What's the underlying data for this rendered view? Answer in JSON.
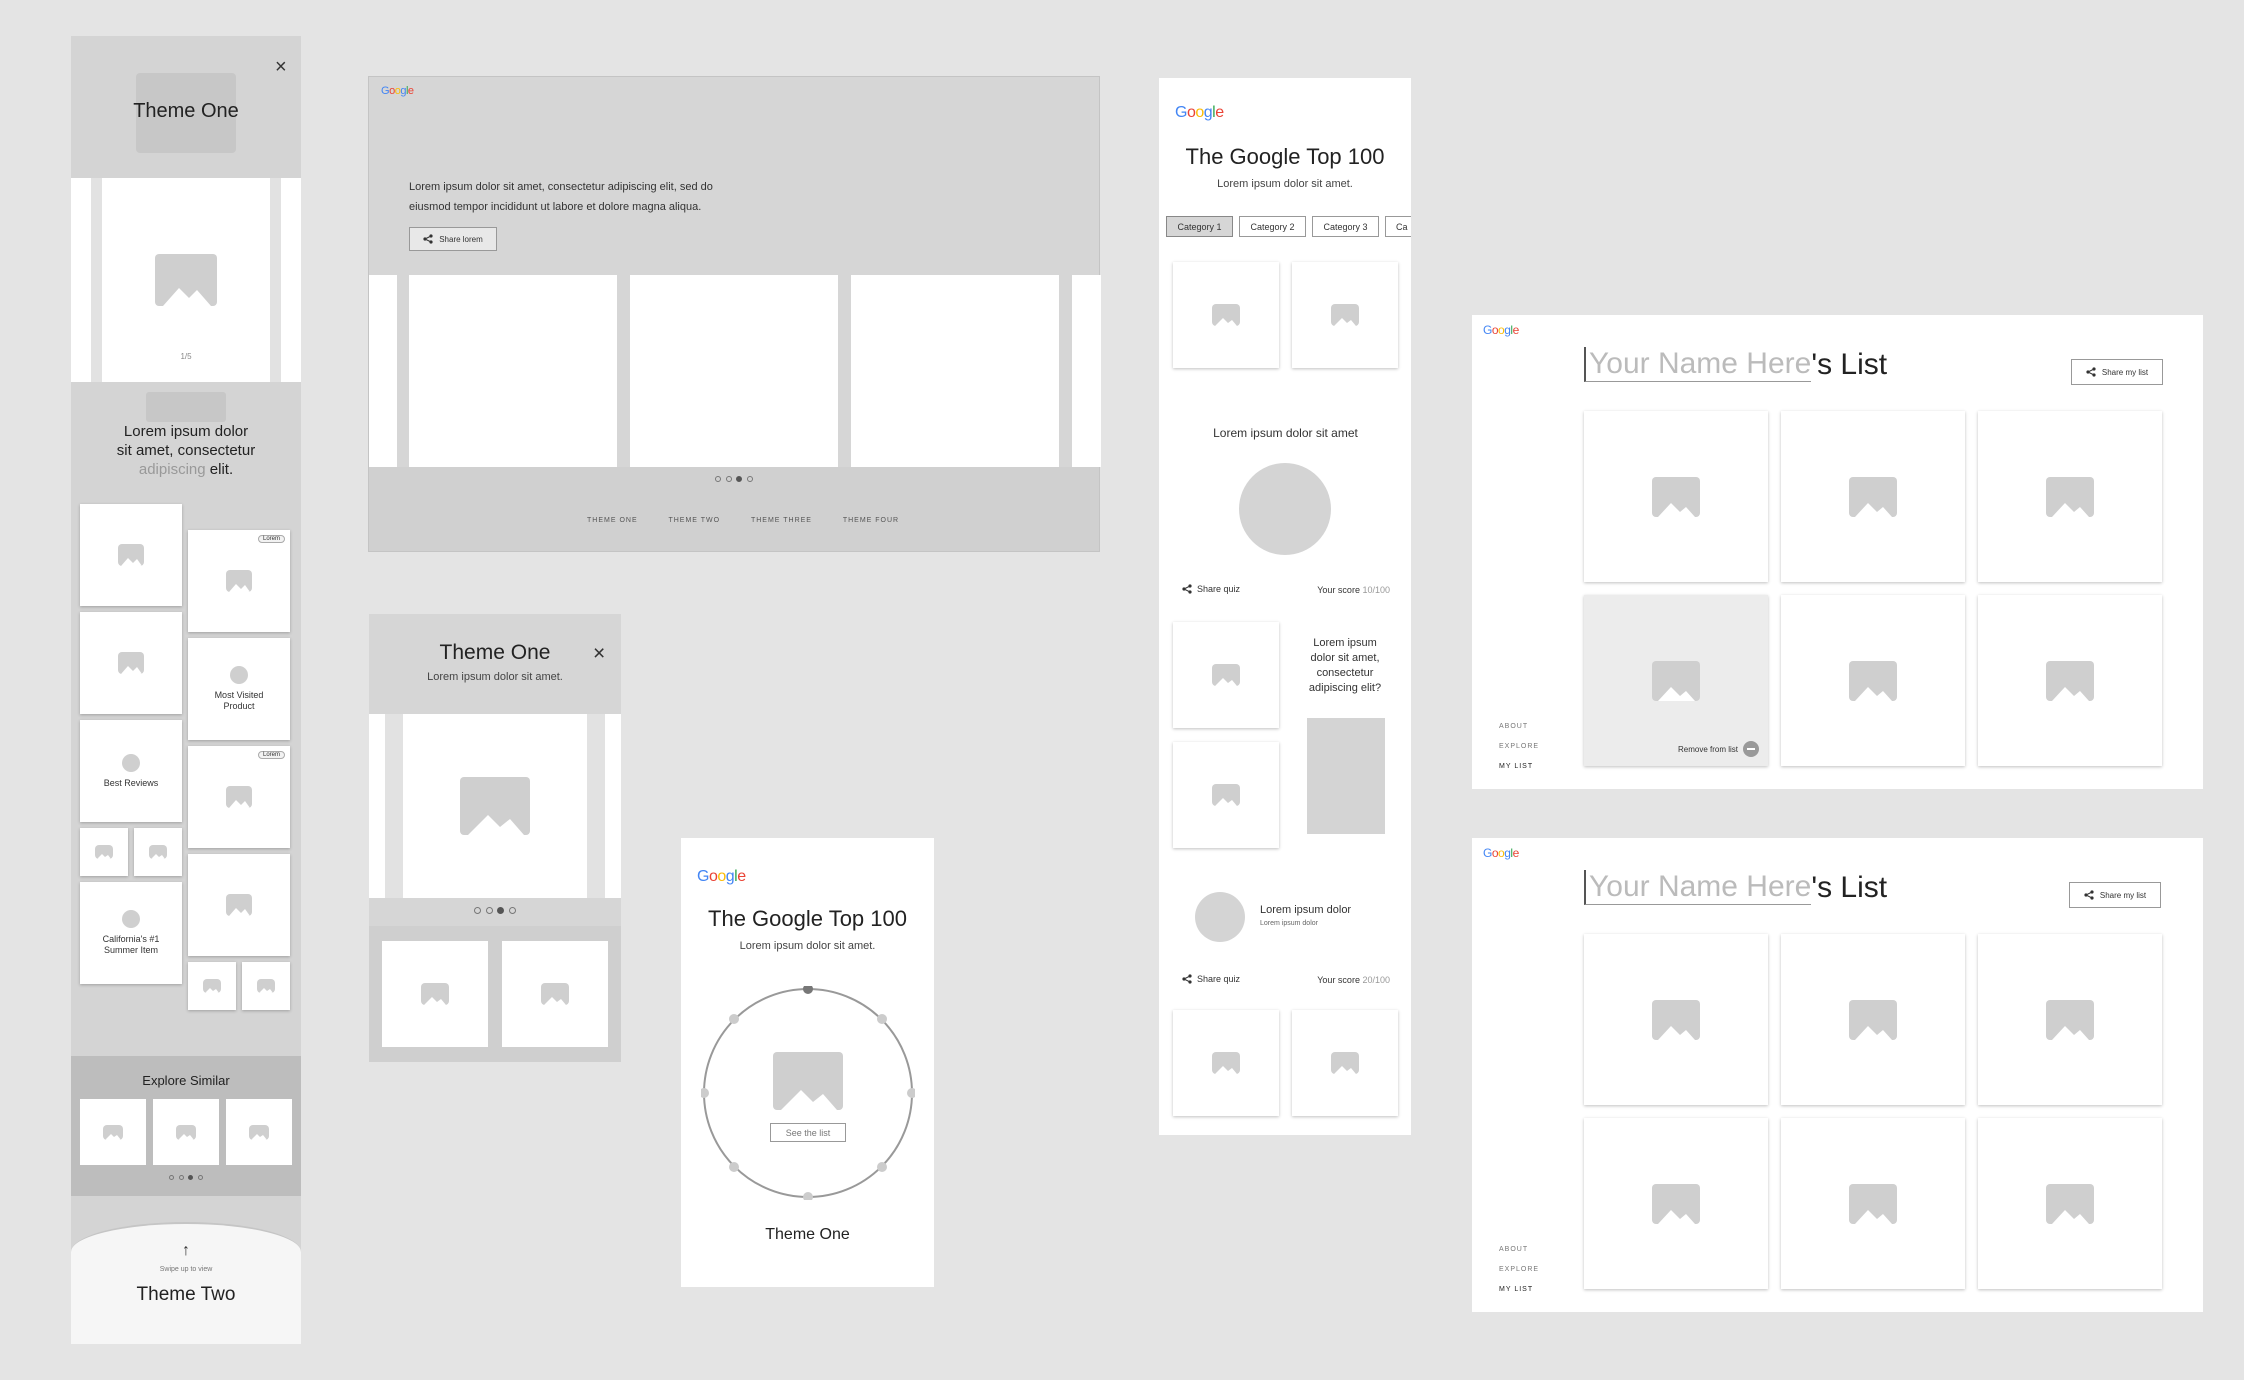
{
  "logo": {
    "part1": "G",
    "part2": "o",
    "part3": "o",
    "part4": "g",
    "part5": "l",
    "part6": "e"
  },
  "mobile1": {
    "title": "Theme One",
    "close": "×",
    "pager": "1/5",
    "blurb_a": "Lorem ipsum dolor",
    "blurb_b": "sit amet, consectetur",
    "blurb_c": "adipiscing",
    "blurb_d": "elit.",
    "badge": "Lorem",
    "most_visited": "Most Visited Product",
    "best_reviews": "Best Reviews",
    "californias": "California's #1 Summer Item",
    "explore_similar": "Explore Similar",
    "swipe": "Swipe up to view",
    "swipe_arrow": "↑",
    "next_theme": "Theme Two"
  },
  "desktop": {
    "text1": "Lorem ipsum dolor sit amet, consectetur adipiscing elit, sed do",
    "text2": "eiusmod tempor incididunt ut labore et dolore magna aliqua.",
    "share": "Share lorem",
    "tabs": [
      "THEME ONE",
      "THEME TWO",
      "THEME THREE",
      "THEME FOUR"
    ]
  },
  "mobile2": {
    "title": "Theme One",
    "subtitle": "Lorem ipsum dolor sit amet.",
    "close": "×"
  },
  "mobile3": {
    "title": "The Google Top 100",
    "subtitle": "Lorem ipsum dolor sit amet.",
    "cta": "See the list",
    "theme": "Theme One"
  },
  "mobile4": {
    "title": "The Google Top 100",
    "subtitle": "Lorem ipsum dolor sit amet.",
    "categories": [
      "Category 1",
      "Category 2",
      "Category 3",
      "Ca"
    ],
    "quiz_title": "Lorem ipsum dolor sit amet",
    "share_quiz": "Share quiz",
    "score_label": "Your score",
    "score1": "10/100",
    "question": "Lorem ipsum dolor sit amet, consectetur adipiscing elit?",
    "item_title": "Lorem ipsum dolor",
    "item_sub": "Lorem ipsum dolor",
    "score2": "20/100"
  },
  "list1": {
    "name_placeholder": "Your Name Here",
    "suffix": "'s List",
    "share": "Share my list",
    "nav": [
      "ABOUT",
      "EXPLORE",
      "MY LIST"
    ],
    "remove": "Remove from list"
  },
  "list2": {
    "name_placeholder": "Your Name Here",
    "suffix": "'s List",
    "share": "Share my list",
    "nav": [
      "ABOUT",
      "EXPLORE",
      "MY LIST"
    ]
  }
}
